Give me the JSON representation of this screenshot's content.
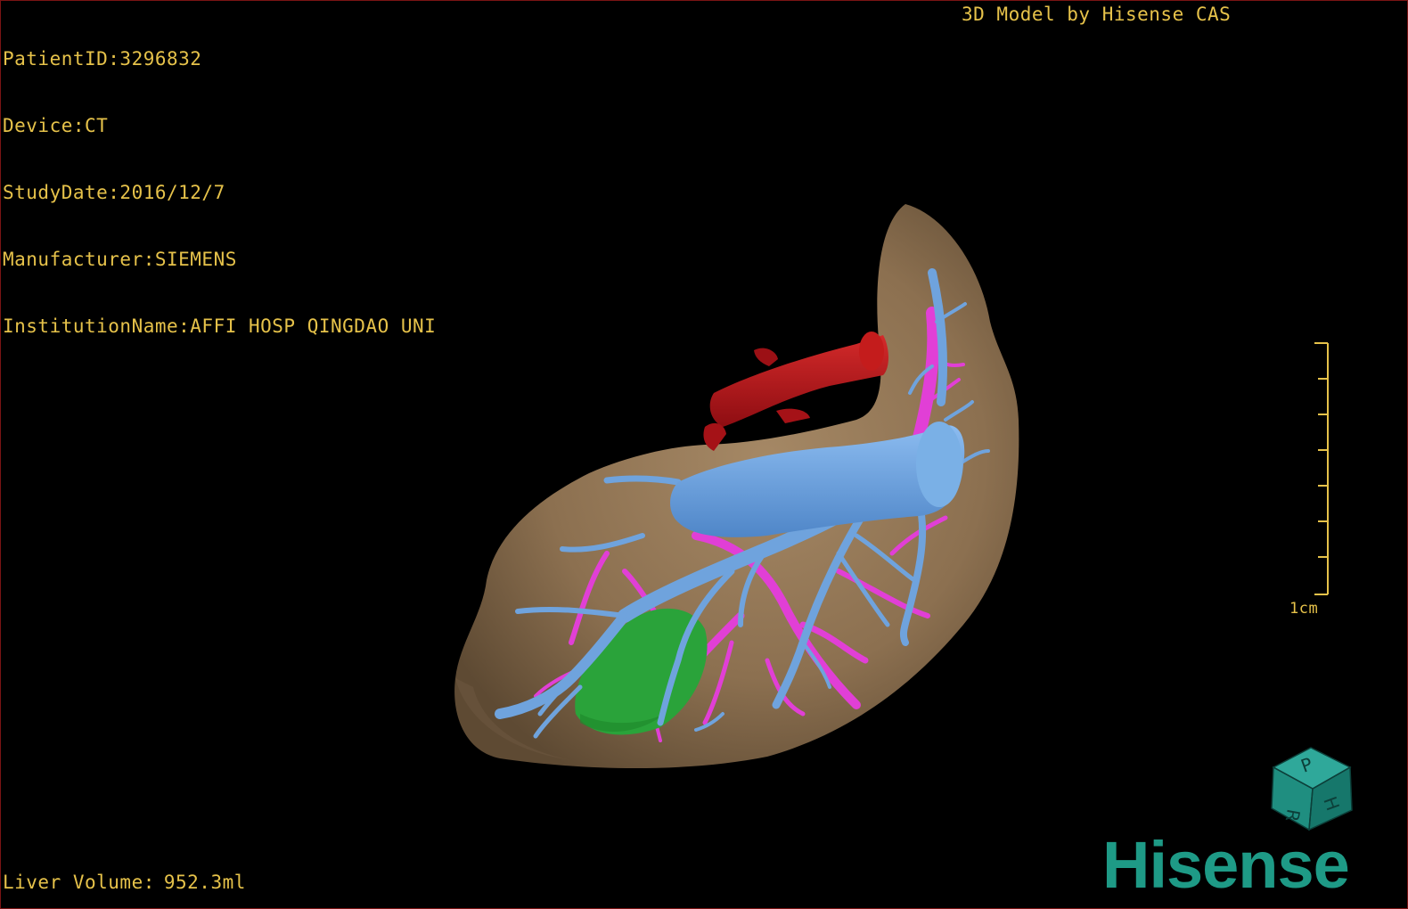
{
  "overlay": {
    "patient": "PatientID:3296832",
    "device": "Device:CT",
    "study_date": "StudyDate:2016/12/7",
    "manufacturer": "Manufacturer:SIEMENS",
    "institution": "InstitutionName:AFFI HOSP QINGDAO UNI",
    "credit": "3D Model by Hisense CAS",
    "volume_label": "Liver Volume:",
    "volume_value": "952.3ml"
  },
  "scale_bar": {
    "label": "1cm",
    "tick_count": 8
  },
  "orientation_cube": {
    "letters": [
      "P",
      "H",
      "R"
    ],
    "icon": "orientation-cube-icon"
  },
  "brand": {
    "logo_text": "Hisense"
  },
  "colors": {
    "overlay_text": "#e6c24a",
    "liver": "#8f7353",
    "hepatic_vein": "#6fa3dd",
    "portal_vein": "#e13fd6",
    "artery": "#b5151b",
    "lesion": "#2aa33a",
    "brand": "#1e9a86",
    "border": "#7a1414"
  }
}
